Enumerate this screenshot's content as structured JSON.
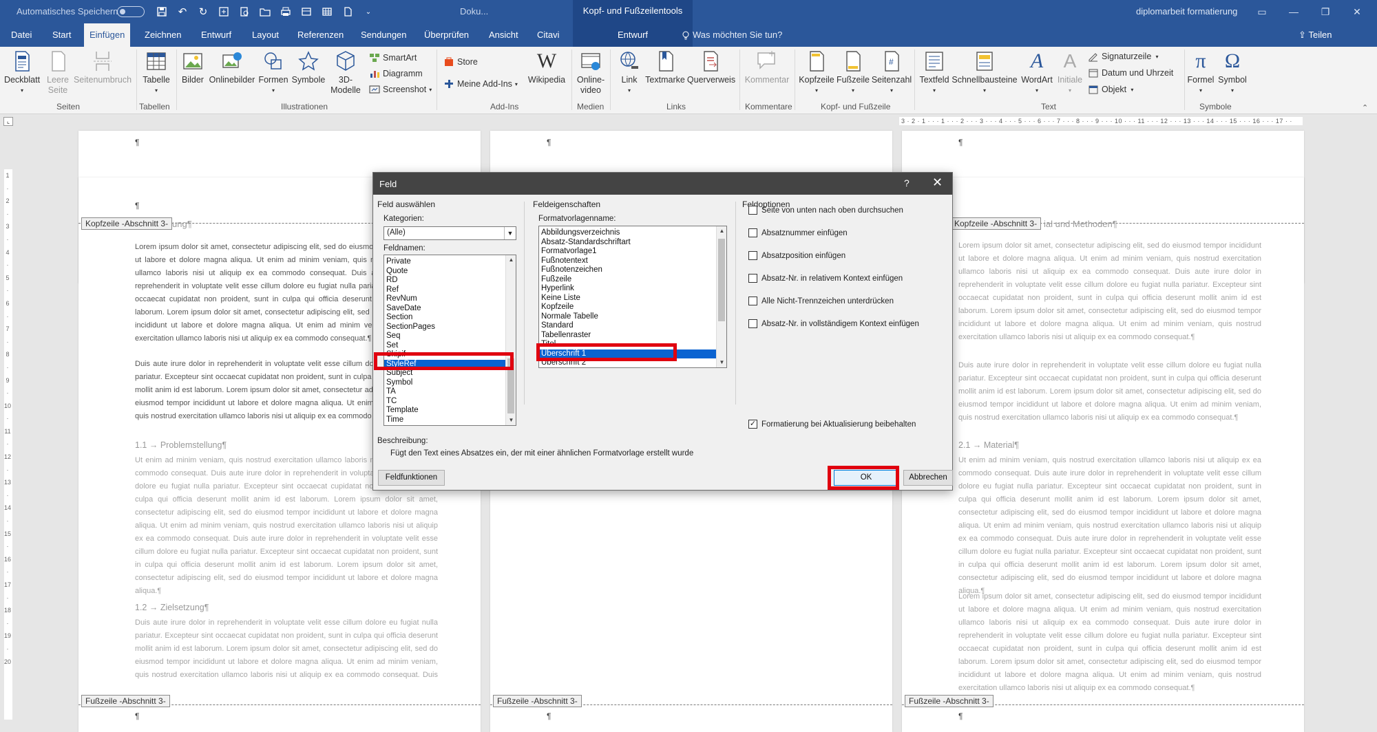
{
  "titlebar": {
    "autosave_label": "Automatisches Speichern",
    "doc_title": "Doku...",
    "context_title": "Kopf- und Fußzeilentools",
    "app_name": "diplomarbeit formatierung"
  },
  "tabs": {
    "items": [
      "Datei",
      "Start",
      "Einfügen",
      "Zeichnen",
      "Entwurf",
      "Layout",
      "Referenzen",
      "Sendungen",
      "Überprüfen",
      "Ansicht",
      "Citavi"
    ],
    "active": "Einfügen",
    "context_tab": "Entwurf",
    "tell_me": "Was möchten Sie tun?",
    "share": "Teilen"
  },
  "ribbon": {
    "buttons": {
      "deckblatt": "Deckblatt",
      "leere_seite": "Leere Seite",
      "seitenumbruch": "Seitenumbruch",
      "tabelle": "Tabelle",
      "bilder": "Bilder",
      "onlinebilder": "Onlinebilder",
      "formen": "Formen",
      "symbole": "Symbole",
      "modelle": "3D-Modelle",
      "smartart": "SmartArt",
      "diagramm": "Diagramm",
      "screenshot": "Screenshot",
      "store": "Store",
      "meine_addins": "Meine Add-Ins",
      "wikipedia": "Wikipedia",
      "onlinevideo": "Online-video",
      "link": "Link",
      "textmarke": "Textmarke",
      "querverweis": "Querverweis",
      "kommentar": "Kommentar",
      "kopfzeile": "Kopfzeile",
      "fusszeile": "Fußzeile",
      "seitenzahl": "Seitenzahl",
      "textfeld": "Textfeld",
      "schnellbausteine": "Schnellbausteine",
      "wordart": "WordArt",
      "initiale": "Initiale",
      "signaturzeile": "Signaturzeile",
      "datum": "Datum und Uhrzeit",
      "objekt": "Objekt",
      "formel": "Formel",
      "symbol": "Symbol"
    },
    "groups": {
      "seiten": "Seiten",
      "tabellen": "Tabellen",
      "illustrationen": "Illustrationen",
      "addins": "Add-Ins",
      "medien": "Medien",
      "links": "Links",
      "kommentare": "Kommentare",
      "kopf_fuss": "Kopf- und Fußzeile",
      "text": "Text",
      "symbole": "Symbole"
    }
  },
  "document": {
    "pilcrow": "¶",
    "header_tag": "Kopfzeile -Abschnitt 3-",
    "footer_tag": "Fußzeile -Abschnitt 3-",
    "left_faint_head": "ung¶",
    "right_faint_head": "ial und Methoden¶",
    "lorem1": "Lorem ipsum dolor sit amet, consectetur adipiscing elit, sed do eiusmod tempor incididunt ut labore et dolore magna aliqua. Ut enim ad minim veniam, quis nostrud exercitation ullamco laboris nisi ut aliquip ex ea commodo consequat. Duis aute irure dolor in reprehenderit in voluptate velit esse cillum dolore eu fugiat nulla pariatur. Excepteur sint occaecat cupidatat non proident, sunt in culpa qui officia deserunt mollit anim id est laborum. Lorem ipsum dolor sit amet, consectetur adipiscing elit, sed do eiusmod tempor incididunt ut labore et dolore magna aliqua. Ut enim ad minim veniam, quis nostrud exercitation ullamco laboris nisi ut aliquip ex ea commodo consequat.¶",
    "lorem2": "Duis aute irure dolor in reprehenderit in voluptate velit esse cillum dolore eu fugiat nulla pariatur. Excepteur sint occaecat cupidatat non proident, sunt in culpa qui officia deserunt mollit anim id est laborum. Lorem ipsum dolor sit amet, consectetur adipiscing elit, sed do eiusmod tempor incididunt ut labore et dolore magna aliqua. Ut enim ad minim veniam, quis nostrud exercitation ullamco laboris nisi ut aliquip ex ea commodo consequat.¶",
    "lorem3": "Ut enim ad minim veniam, quis nostrud exercitation ullamco laboris nisi ut aliquip ex ea commodo consequat. Duis aute irure dolor in reprehenderit in voluptate velit esse cillum dolore eu fugiat nulla pariatur. Excepteur sint occaecat cupidatat non proident, sunt in culpa qui officia deserunt mollit anim id est laborum. Lorem ipsum dolor sit amet, consectetur adipiscing elit, sed do eiusmod tempor incididunt ut labore et dolore magna aliqua. Ut enim ad minim veniam, quis nostrud exercitation ullamco laboris nisi ut aliquip ex ea commodo consequat. Duis aute irure dolor in reprehenderit in voluptate velit esse cillum dolore eu fugiat nulla pariatur. Excepteur sint occaecat cupidatat non proident, sunt in culpa qui officia deserunt mollit anim id est laborum. Lorem ipsum dolor sit amet, consectetur adipiscing elit, sed do eiusmod tempor incididunt ut labore et dolore magna aliqua.¶",
    "lorem4": "Duis aute irure dolor in reprehenderit in voluptate velit esse cillum dolore eu fugiat nulla pariatur. Excepteur sint occaecat cupidatat non proident, sunt in culpa qui officia deserunt mollit anim id est laborum. Lorem ipsum dolor sit amet, consectetur adipiscing elit, sed do eiusmod tempor incididunt ut labore et dolore magna aliqua. Ut enim ad minim veniam, quis nostrud exercitation ullamco laboris nisi ut aliquip ex ea commodo consequat. Duis aute irure dolor in reprehenderit in voluptate velit esse cillum dolore eu fugiat nulla pariatur.",
    "heading_1_1": "1.1 → Problemstellung¶",
    "heading_1_2": "1.2 → Zielsetzung¶",
    "heading_2_1": "2.1 → Material¶"
  },
  "dialog": {
    "title": "Feld",
    "help": "?",
    "close": "✕",
    "left_section": "Feld auswählen",
    "kategorien_label": "Kategorien:",
    "kategorien_value": "(Alle)",
    "feldnamen_label": "Feldnamen:",
    "feldnamen": [
      "Private",
      "Quote",
      "RD",
      "Ref",
      "RevNum",
      "SaveDate",
      "Section",
      "SectionPages",
      "Seq",
      "Set",
      "Skipif",
      "StyleRef",
      "Subject",
      "Symbol",
      "TA",
      "TC",
      "Template",
      "Time"
    ],
    "feldnamen_selected": "StyleRef",
    "mid_section": "Feldeigenschaften",
    "formatvorlage_label": "Formatvorlagenname:",
    "formatvorlagen": [
      "Abbildungsverzeichnis",
      "Absatz-Standardschriftart",
      "Formatvorlage1",
      "Fußnotentext",
      "Fußnotenzeichen",
      "Fußzeile",
      "Hyperlink",
      "Keine Liste",
      "Kopfzeile",
      "Normale Tabelle",
      "Standard",
      "Tabellenraster",
      "Titel",
      "Überschrift 1",
      "Überschrift 2"
    ],
    "formatvorlage_selected": "Überschrift 1",
    "right_section": "Feldoptionen",
    "options": [
      {
        "label": "Seite von unten nach oben durchsuchen",
        "checked": false
      },
      {
        "label": "Absatznummer einfügen",
        "checked": false
      },
      {
        "label": "Absatzposition einfügen",
        "checked": false
      },
      {
        "label": "Absatz-Nr. in relativem Kontext einfügen",
        "checked": false
      },
      {
        "label": "Alle Nicht-Trennzeichen unterdrücken",
        "checked": false
      },
      {
        "label": "Absatz-Nr. in vollständigem Kontext einfügen",
        "checked": false
      }
    ],
    "keep_format": {
      "label": "Formatierung bei Aktualisierung beibehalten",
      "checked": true
    },
    "beschreibung_label": "Beschreibung:",
    "beschreibung_text": "Fügt den Text eines Absatzes ein, der mit einer ähnlichen Formatvorlage erstellt wurde",
    "feldfunktionen": "Feldfunktionen",
    "ok": "OK",
    "abbrechen": "Abbrechen"
  },
  "colors": {
    "word_blue": "#2b579a",
    "context_blue": "#1f4787",
    "selection": "#0a63d1",
    "highlight_red": "#e0000f"
  }
}
